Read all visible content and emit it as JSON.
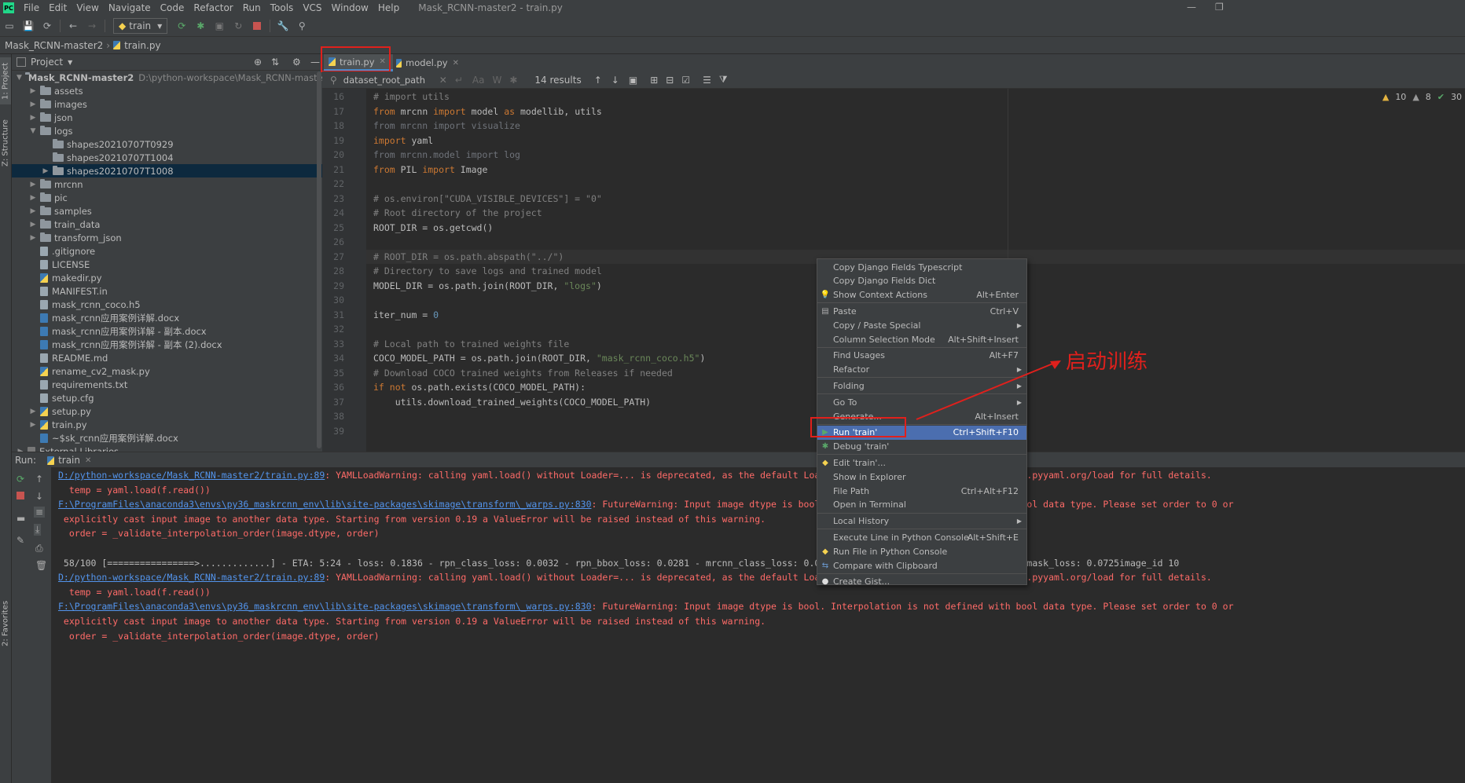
{
  "app": {
    "logo": "PC",
    "title": "Mask_RCNN-master2 - train.py",
    "menu": [
      "File",
      "Edit",
      "View",
      "Navigate",
      "Code",
      "Refactor",
      "Run",
      "Tools",
      "VCS",
      "Window",
      "Help"
    ]
  },
  "toolbar": {
    "run_config": "train"
  },
  "breadcrumb": {
    "project": "Mask_RCNN-master2",
    "file": "train.py"
  },
  "stripes": {
    "project": "1: Project",
    "structure": "Z: Structure",
    "favorites": "2: Favorites"
  },
  "project": {
    "header": "Project",
    "root_name": "Mask_RCNN-master2",
    "root_path": "D:\\python-workspace\\Mask_RCNN-master2",
    "items": [
      {
        "label": "assets",
        "type": "folder",
        "level": 1,
        "chevron": "right"
      },
      {
        "label": "images",
        "type": "folder",
        "level": 1,
        "chevron": "right"
      },
      {
        "label": "json",
        "type": "folder",
        "level": 1,
        "chevron": "right"
      },
      {
        "label": "logs",
        "type": "folder",
        "level": 1,
        "chevron": "down"
      },
      {
        "label": "shapes20210707T0929",
        "type": "folder",
        "level": 2,
        "chevron": ""
      },
      {
        "label": "shapes20210707T1004",
        "type": "folder",
        "level": 2,
        "chevron": ""
      },
      {
        "label": "shapes20210707T1008",
        "type": "folder",
        "level": 2,
        "chevron": "right",
        "selected": true
      },
      {
        "label": "mrcnn",
        "type": "folder",
        "level": 1,
        "chevron": "right"
      },
      {
        "label": "pic",
        "type": "folder",
        "level": 1,
        "chevron": "right"
      },
      {
        "label": "samples",
        "type": "folder",
        "level": 1,
        "chevron": "right"
      },
      {
        "label": "train_data",
        "type": "folder",
        "level": 1,
        "chevron": "right"
      },
      {
        "label": "transform_json",
        "type": "folder",
        "level": 1,
        "chevron": "right"
      },
      {
        "label": ".gitignore",
        "type": "txt",
        "level": 1,
        "chevron": ""
      },
      {
        "label": "LICENSE",
        "type": "txt",
        "level": 1,
        "chevron": ""
      },
      {
        "label": "makedir.py",
        "type": "py",
        "level": 1,
        "chevron": ""
      },
      {
        "label": "MANIFEST.in",
        "type": "txt",
        "level": 1,
        "chevron": ""
      },
      {
        "label": "mask_rcnn_coco.h5",
        "type": "txt",
        "level": 1,
        "chevron": ""
      },
      {
        "label": "mask_rcnn应用案例详解.docx",
        "type": "doc",
        "level": 1,
        "chevron": ""
      },
      {
        "label": "mask_rcnn应用案例详解 - 副本.docx",
        "type": "doc",
        "level": 1,
        "chevron": ""
      },
      {
        "label": "mask_rcnn应用案例详解 - 副本 (2).docx",
        "type": "doc",
        "level": 1,
        "chevron": ""
      },
      {
        "label": "README.md",
        "type": "txt",
        "level": 1,
        "chevron": ""
      },
      {
        "label": "rename_cv2_mask.py",
        "type": "py",
        "level": 1,
        "chevron": ""
      },
      {
        "label": "requirements.txt",
        "type": "txt",
        "level": 1,
        "chevron": ""
      },
      {
        "label": "setup.cfg",
        "type": "txt",
        "level": 1,
        "chevron": ""
      },
      {
        "label": "setup.py",
        "type": "py",
        "level": 1,
        "chevron": "right"
      },
      {
        "label": "train.py",
        "type": "py",
        "level": 1,
        "chevron": "right"
      },
      {
        "label": "~$sk_rcnn应用案例详解.docx",
        "type": "doc",
        "level": 1,
        "chevron": ""
      },
      {
        "label": "External Libraries",
        "type": "lib",
        "level": 0,
        "chevron": "right"
      }
    ]
  },
  "editor": {
    "tabs": [
      {
        "label": "train.py",
        "active": true
      },
      {
        "label": "model.py",
        "active": false
      }
    ],
    "search_query": "dataset_root_path",
    "results": "14 results",
    "inspections": {
      "warnings": "10",
      "weak": "8",
      "ok": "30"
    },
    "lines": [
      {
        "n": "16",
        "segs": [
          {
            "t": "# import utils",
            "c": "cm"
          }
        ]
      },
      {
        "n": "17",
        "segs": [
          {
            "t": "from ",
            "c": "kw"
          },
          {
            "t": "mrcnn ",
            "c": ""
          },
          {
            "t": "import ",
            "c": "kw"
          },
          {
            "t": "model ",
            "c": ""
          },
          {
            "t": "as ",
            "c": "kw"
          },
          {
            "t": "modellib, utils",
            "c": ""
          }
        ]
      },
      {
        "n": "18",
        "segs": [
          {
            "t": "from mrcnn import visualize",
            "c": "dim"
          }
        ]
      },
      {
        "n": "19",
        "segs": [
          {
            "t": "import ",
            "c": "kw"
          },
          {
            "t": "yaml",
            "c": ""
          }
        ]
      },
      {
        "n": "20",
        "segs": [
          {
            "t": "from mrcnn.model import log",
            "c": "dim"
          }
        ]
      },
      {
        "n": "21",
        "segs": [
          {
            "t": "from ",
            "c": "kw"
          },
          {
            "t": "PIL ",
            "c": ""
          },
          {
            "t": "import ",
            "c": "kw"
          },
          {
            "t": "Image",
            "c": ""
          }
        ]
      },
      {
        "n": "22",
        "segs": []
      },
      {
        "n": "23",
        "segs": [
          {
            "t": "# os.environ[\"CUDA_VISIBLE_DEVICES\"] = \"0\"",
            "c": "cm"
          }
        ]
      },
      {
        "n": "24",
        "segs": [
          {
            "t": "# Root directory of the project",
            "c": "cm"
          }
        ]
      },
      {
        "n": "25",
        "segs": [
          {
            "t": "ROOT_DIR = os.getcwd()",
            "c": ""
          }
        ]
      },
      {
        "n": "26",
        "segs": []
      },
      {
        "n": "27",
        "segs": [
          {
            "t": "# ROOT_DIR = os.path.abspath(\"../\")",
            "c": "cm"
          }
        ]
      },
      {
        "n": "28",
        "segs": [
          {
            "t": "# Directory to save logs and trained model",
            "c": "cm"
          }
        ]
      },
      {
        "n": "29",
        "segs": [
          {
            "t": "MODEL_DIR = os.path.join(ROOT_DIR, ",
            "c": ""
          },
          {
            "t": "\"logs\"",
            "c": "str"
          },
          {
            "t": ")",
            "c": ""
          }
        ]
      },
      {
        "n": "30",
        "segs": []
      },
      {
        "n": "31",
        "segs": [
          {
            "t": "iter_num = ",
            "c": ""
          },
          {
            "t": "0",
            "c": "num"
          }
        ]
      },
      {
        "n": "32",
        "segs": []
      },
      {
        "n": "33",
        "segs": [
          {
            "t": "# Local path to trained weights file",
            "c": "cm"
          }
        ]
      },
      {
        "n": "34",
        "segs": [
          {
            "t": "COCO_MODEL_PATH = os.path.join(ROOT_DIR, ",
            "c": ""
          },
          {
            "t": "\"mask_rcnn_coco.h5\"",
            "c": "str"
          },
          {
            "t": ")",
            "c": ""
          }
        ]
      },
      {
        "n": "35",
        "segs": [
          {
            "t": "# Download COCO trained weights from Releases if needed",
            "c": "cm"
          }
        ]
      },
      {
        "n": "36",
        "segs": [
          {
            "t": "if not ",
            "c": "kw"
          },
          {
            "t": "os.path.exists(COCO_MODEL_PATH):",
            "c": ""
          }
        ]
      },
      {
        "n": "37",
        "segs": [
          {
            "t": "    utils.download_trained_weights(COCO_MODEL_PATH)",
            "c": ""
          }
        ]
      },
      {
        "n": "38",
        "segs": []
      },
      {
        "n": "39",
        "segs": []
      }
    ]
  },
  "run": {
    "label": "Run:",
    "tab": "train",
    "lines": [
      {
        "segs": [
          {
            "t": "D:/python-workspace/Mask_RCNN-master2/train.py:89",
            "c": "link"
          },
          {
            "t": ": YAMLLoadWarning: calling yaml.load() without Loader=... is deprecated, as the default Loader is unsafe. Please read https://msg.pyyaml.org/load for full details.",
            "c": ""
          }
        ]
      },
      {
        "segs": [
          {
            "t": "  temp = yaml.load(f.read())",
            "c": ""
          }
        ]
      },
      {
        "segs": [
          {
            "t": "F:\\ProgramFiles\\anaconda3\\envs\\py36_maskrcnn_env\\lib\\site-packages\\skimage\\transform\\_warps.py:830",
            "c": "link"
          },
          {
            "t": ": FutureWarning: Input image dtype is bool. Interpolation is not defined with bool data type. Please set order to 0 or",
            "c": ""
          }
        ]
      },
      {
        "segs": [
          {
            "t": " explicitly cast input image to another data type. Starting from version 0.19 a ValueError will be raised instead of this warning.",
            "c": ""
          }
        ]
      },
      {
        "segs": [
          {
            "t": "  order = _validate_interpolation_order(image.dtype, order)",
            "c": ""
          }
        ]
      },
      {
        "segs": []
      },
      {
        "segs": [
          {
            "t": " 58/100 [================>.............] - ETA: 5:24 - loss: 0.1836 - rpn_class_loss: 0.0032 - rpn_bbox_loss: 0.0281 - mrcnn_class_loss: 0.0211 - mrcnn_bbox_loss: 0.0587 - mrcnn_mask_loss: 0.0725image_id 10",
            "c": "wh"
          }
        ]
      },
      {
        "segs": [
          {
            "t": "D:/python-workspace/Mask_RCNN-master2/train.py:89",
            "c": "link"
          },
          {
            "t": ": YAMLLoadWarning: calling yaml.load() without Loader=... is deprecated, as the default Loader is unsafe. Please read https://msg.pyyaml.org/load for full details.",
            "c": ""
          }
        ]
      },
      {
        "segs": [
          {
            "t": "  temp = yaml.load(f.read())",
            "c": ""
          }
        ]
      },
      {
        "segs": [
          {
            "t": "F:\\ProgramFiles\\anaconda3\\envs\\py36_maskrcnn_env\\lib\\site-packages\\skimage\\transform\\_warps.py:830",
            "c": "link"
          },
          {
            "t": ": FutureWarning: Input image dtype is bool. Interpolation is not defined with bool data type. Please set order to 0 or",
            "c": ""
          }
        ]
      },
      {
        "segs": [
          {
            "t": " explicitly cast input image to another data type. Starting from version 0.19 a ValueError will be raised instead of this warning.",
            "c": ""
          }
        ]
      },
      {
        "segs": [
          {
            "t": "  order = _validate_interpolation_order(image.dtype, order)",
            "c": ""
          }
        ]
      }
    ]
  },
  "context_menu": {
    "items": [
      {
        "label": "Copy Django Fields Typescript",
        "shortcut": "",
        "icon": ""
      },
      {
        "label": "Copy Django Fields Dict",
        "shortcut": "",
        "icon": ""
      },
      {
        "label": "Show Context Actions",
        "shortcut": "Alt+Enter",
        "icon": "bulb"
      },
      {
        "sep": true
      },
      {
        "label": "Paste",
        "shortcut": "Ctrl+V",
        "icon": "paste"
      },
      {
        "label": "Copy / Paste Special",
        "shortcut": "",
        "submenu": true
      },
      {
        "label": "Column Selection Mode",
        "shortcut": "Alt+Shift+Insert"
      },
      {
        "sep": true
      },
      {
        "label": "Find Usages",
        "shortcut": "Alt+F7"
      },
      {
        "label": "Refactor",
        "shortcut": "",
        "submenu": true
      },
      {
        "sep": true
      },
      {
        "label": "Folding",
        "shortcut": "",
        "submenu": true
      },
      {
        "sep": true
      },
      {
        "label": "Go To",
        "shortcut": "",
        "submenu": true
      },
      {
        "label": "Generate...",
        "shortcut": "Alt+Insert"
      },
      {
        "sep": true
      },
      {
        "label": "Run 'train'",
        "shortcut": "Ctrl+Shift+F10",
        "icon": "run",
        "highlight": true
      },
      {
        "label": "Debug 'train'",
        "shortcut": "",
        "icon": "debug"
      },
      {
        "sep": true
      },
      {
        "label": "Edit 'train'...",
        "shortcut": "",
        "icon": "python"
      },
      {
        "label": "Show in Explorer",
        "shortcut": ""
      },
      {
        "label": "File Path",
        "shortcut": "Ctrl+Alt+F12"
      },
      {
        "label": "Open in Terminal",
        "shortcut": ""
      },
      {
        "sep": true
      },
      {
        "label": "Local History",
        "shortcut": "",
        "submenu": true
      },
      {
        "sep": true
      },
      {
        "label": "Execute Line in Python Console",
        "shortcut": "Alt+Shift+E"
      },
      {
        "label": "Run File in Python Console",
        "shortcut": "",
        "icon": "python"
      },
      {
        "label": "Compare with Clipboard",
        "shortcut": "",
        "icon": "compare"
      },
      {
        "sep": true
      },
      {
        "label": "Create Gist...",
        "shortcut": "",
        "icon": "github"
      }
    ]
  },
  "annotation": {
    "text": "启动训练",
    "color": "#e0201c"
  },
  "colors": {
    "accent": "#4b6eaf",
    "annotation": "#e0201c",
    "keyword": "#cc7832",
    "comment": "#808080",
    "string": "#6a8759",
    "error_text": "#ff6b68",
    "link": "#5394ec"
  }
}
